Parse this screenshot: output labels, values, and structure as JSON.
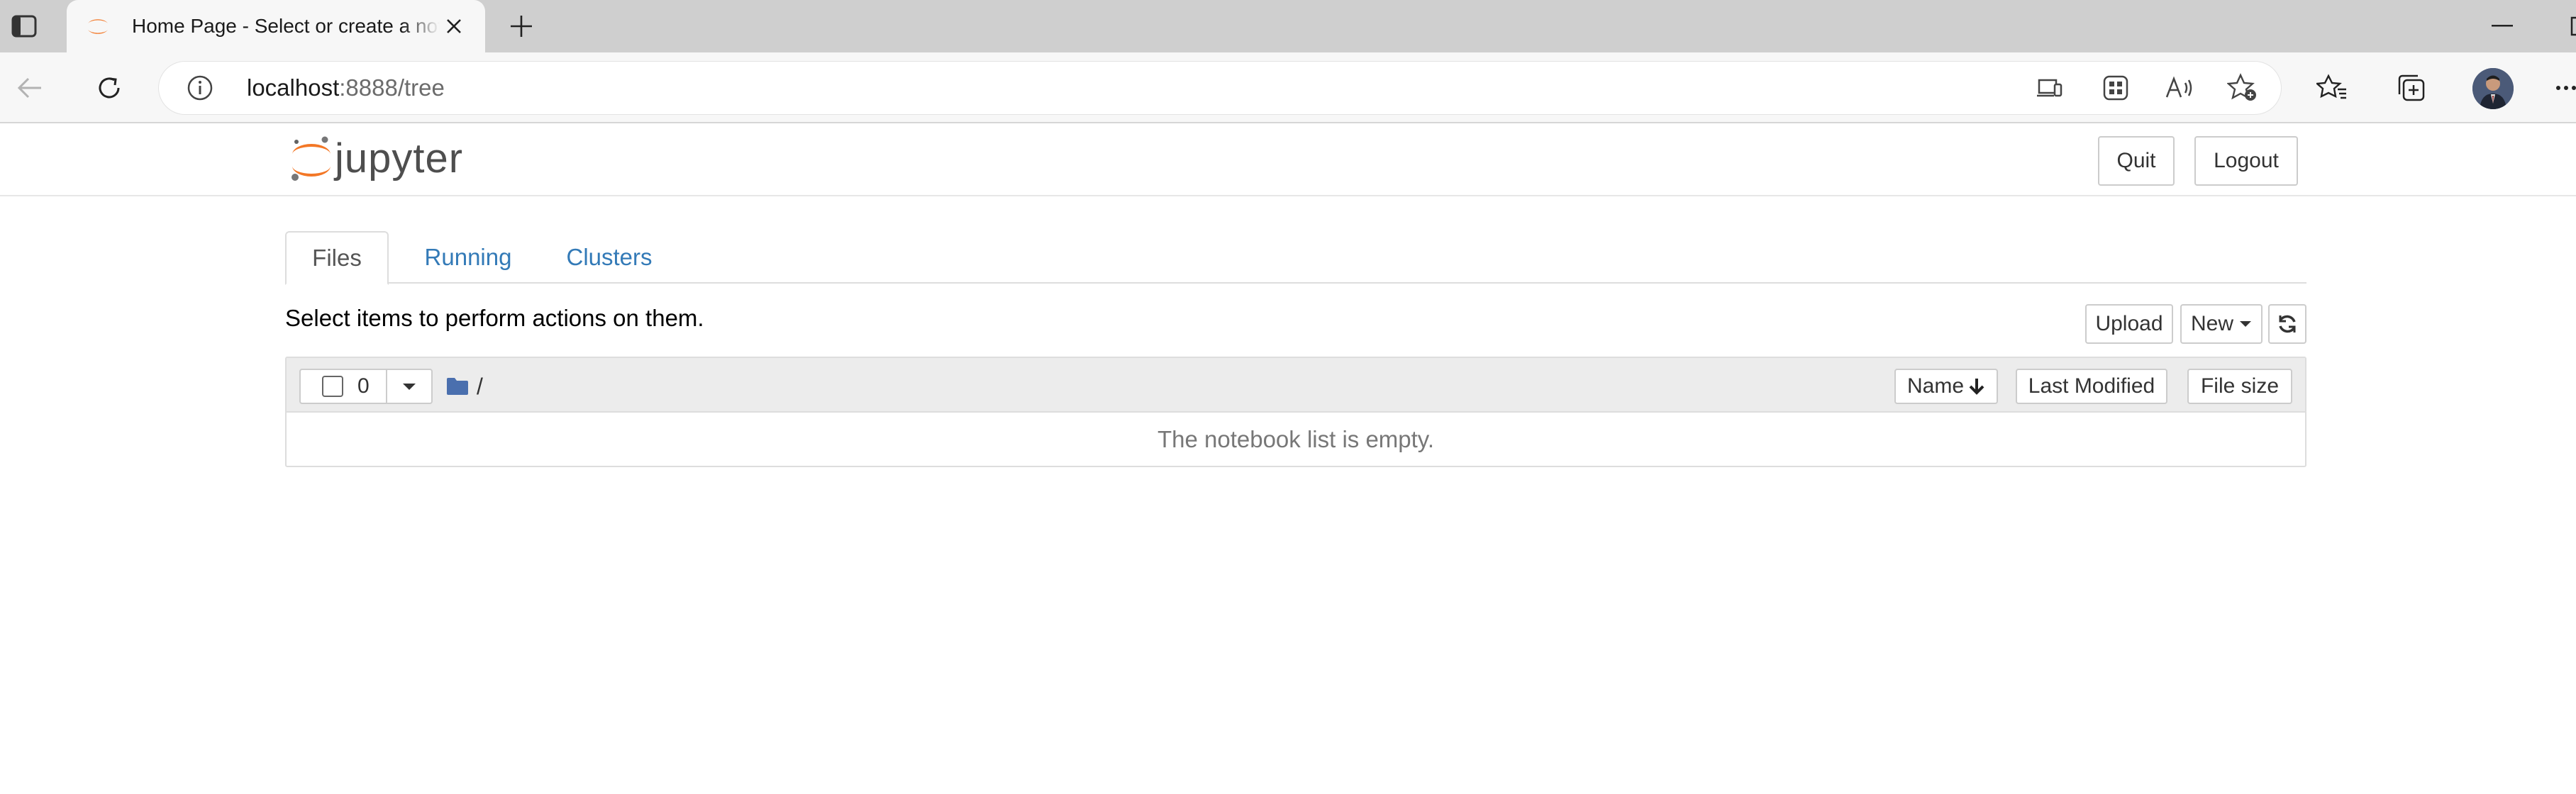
{
  "browser": {
    "tab_title": "Home Page - Select or create a notebook",
    "url_host": "localhost",
    "url_rest": ":8888/tree"
  },
  "jupyter": {
    "logo_text": "jupyter",
    "quit_label": "Quit",
    "logout_label": "Logout",
    "tabs": [
      {
        "label": "Files",
        "active": true
      },
      {
        "label": "Running",
        "active": false
      },
      {
        "label": "Clusters",
        "active": false
      }
    ],
    "select_message": "Select items to perform actions on them.",
    "upload_label": "Upload",
    "new_label": "New",
    "selected_count": "0",
    "breadcrumb_root": "/",
    "columns": {
      "name": "Name",
      "last_modified": "Last Modified",
      "file_size": "File size"
    },
    "empty_message": "The notebook list is empty."
  },
  "colors": {
    "link": "#337ab7",
    "jupyter_orange": "#f37726",
    "folder_blue": "#4a6fae"
  }
}
